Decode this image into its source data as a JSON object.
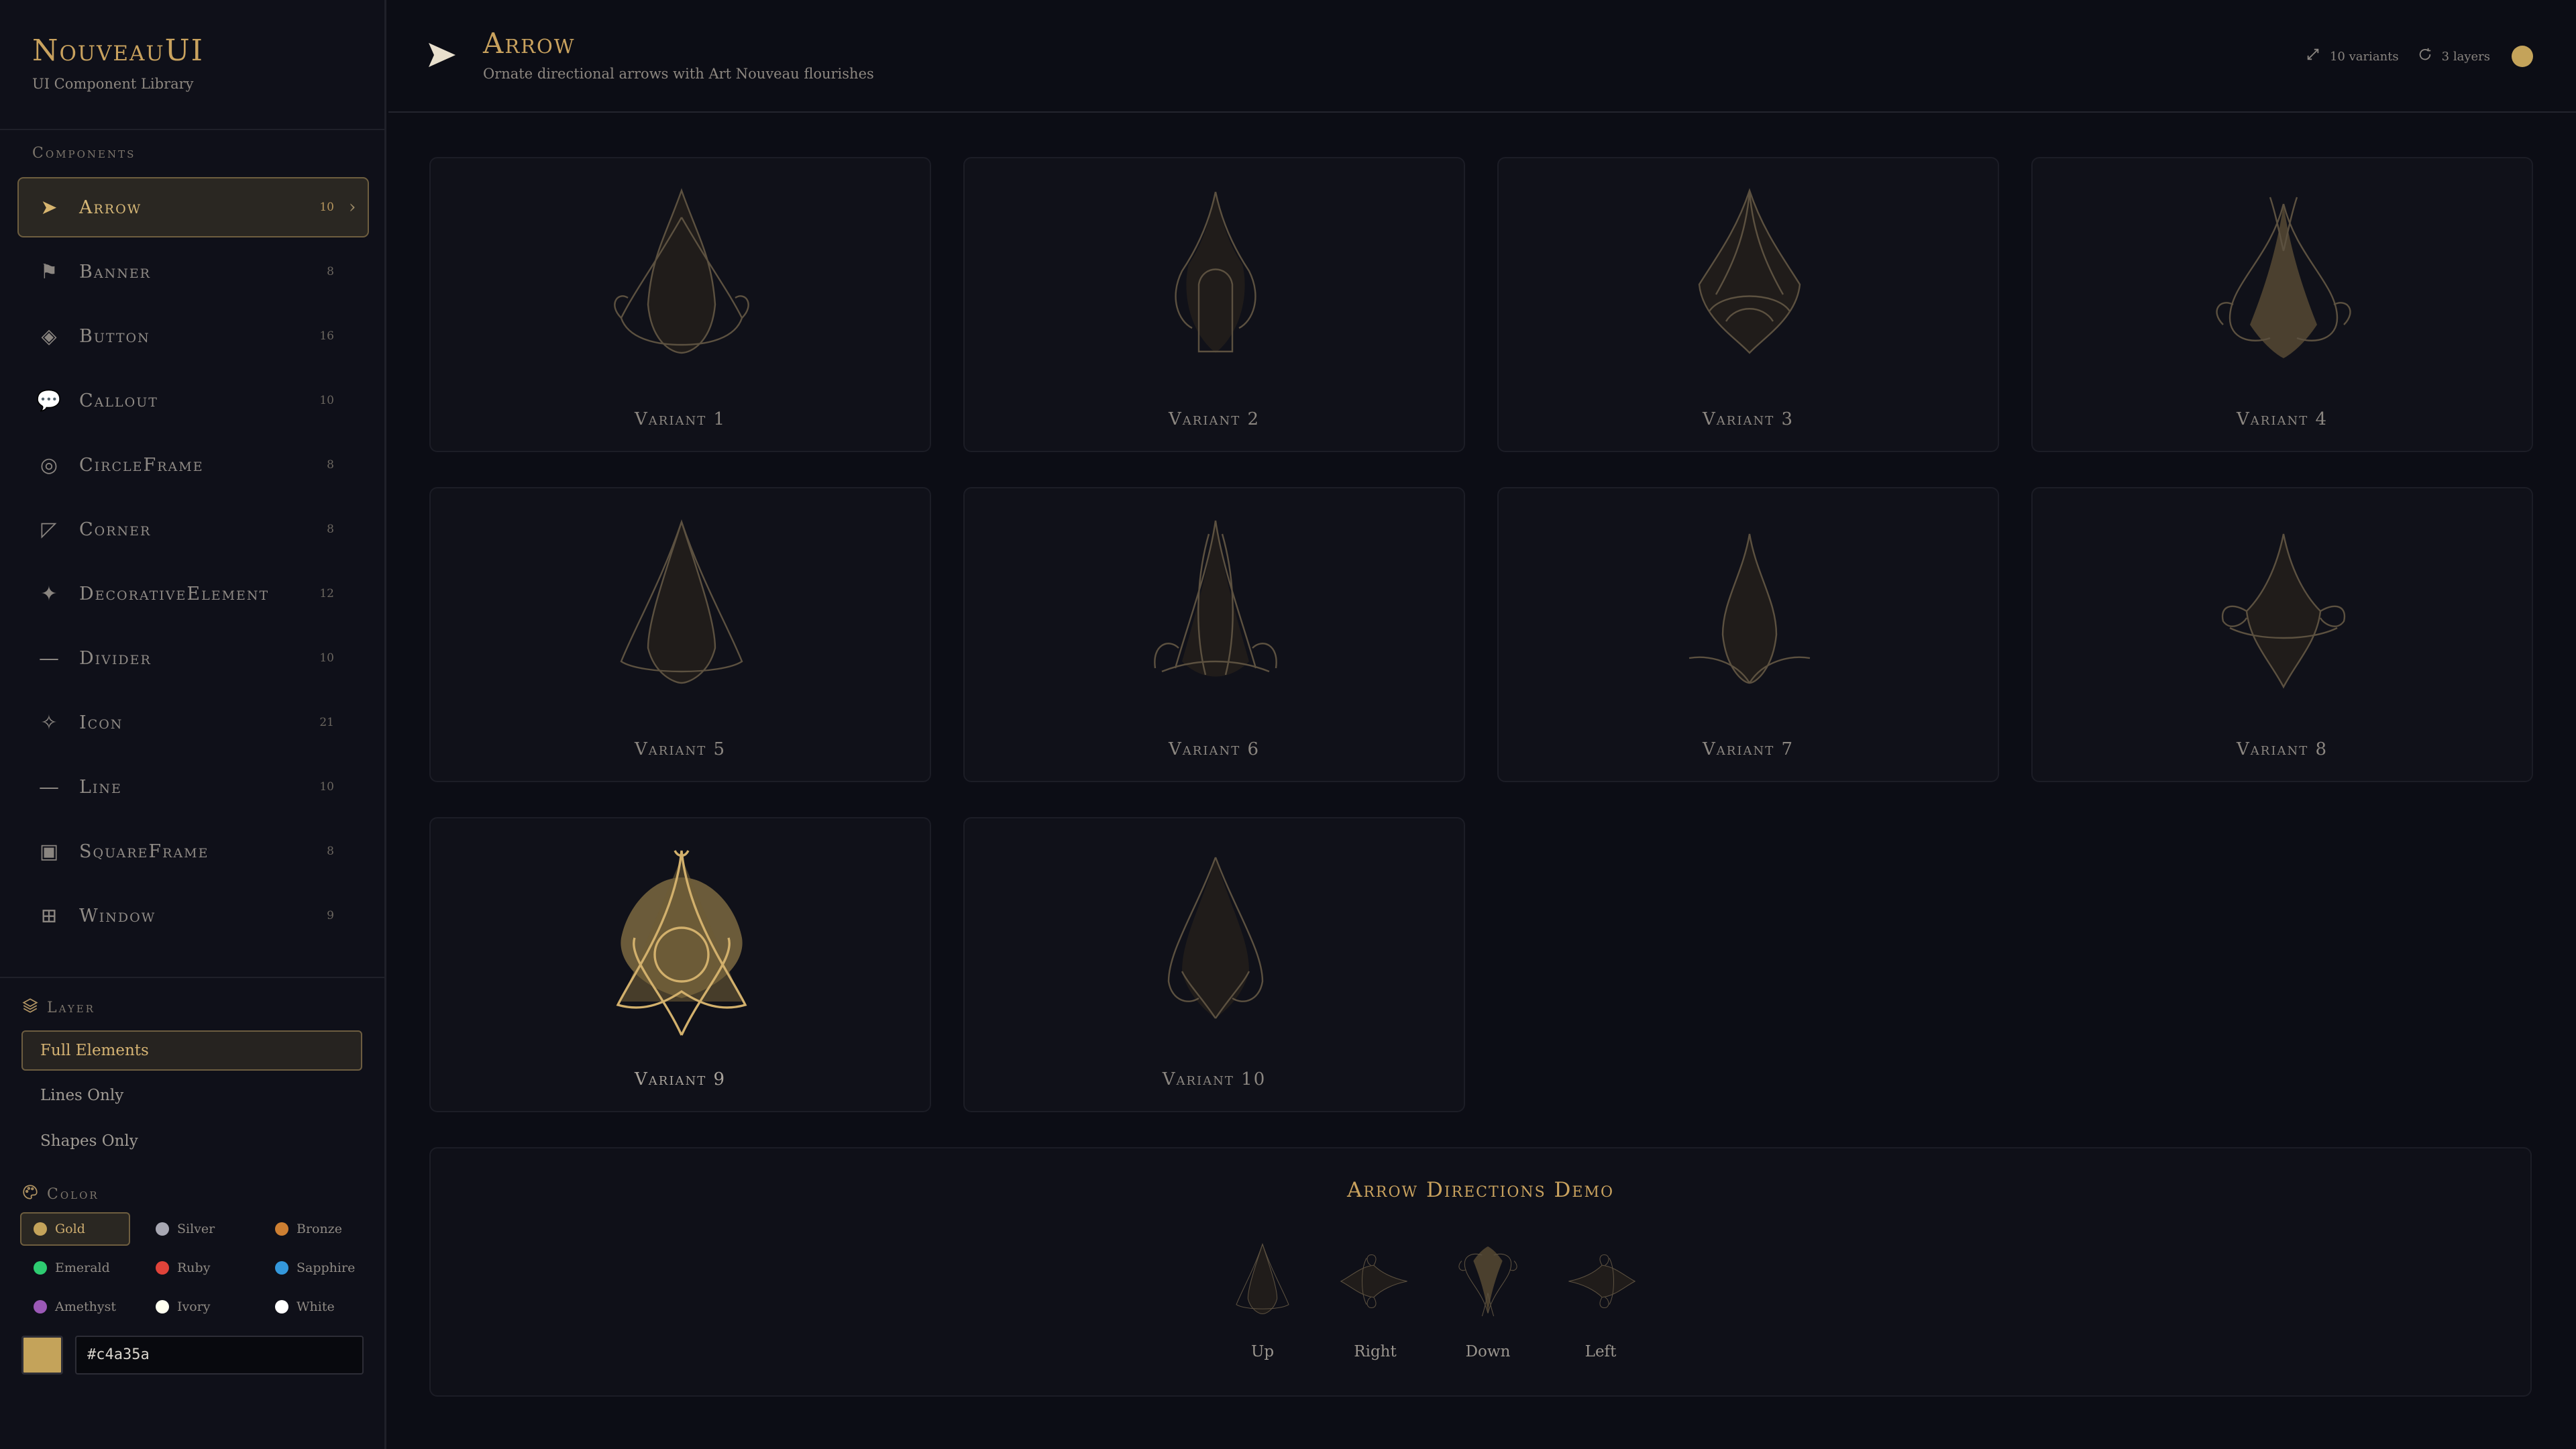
{
  "brand": {
    "title": "NouveauUI",
    "subtitle": "UI Component Library"
  },
  "sidebar": {
    "section_label": "Components",
    "items": [
      {
        "label": "Arrow",
        "count": "10",
        "icon": "arrow-icon",
        "glyph": "➤",
        "active": true
      },
      {
        "label": "Banner",
        "count": "8",
        "icon": "banner-flag-icon",
        "glyph": "⚑",
        "active": false
      },
      {
        "label": "Button",
        "count": "16",
        "icon": "button-diamond-icon",
        "glyph": "◈",
        "active": false
      },
      {
        "label": "Callout",
        "count": "10",
        "icon": "speech-bubble-icon",
        "glyph": "💬",
        "active": false
      },
      {
        "label": "CircleFrame",
        "count": "8",
        "icon": "circle-frame-icon",
        "glyph": "◎",
        "active": false
      },
      {
        "label": "Corner",
        "count": "8",
        "icon": "corner-icon",
        "glyph": "◸",
        "active": false
      },
      {
        "label": "DecorativeElement",
        "count": "12",
        "icon": "sparkle-icon",
        "glyph": "✦",
        "active": false
      },
      {
        "label": "Divider",
        "count": "10",
        "icon": "divider-icon",
        "glyph": "—",
        "active": false
      },
      {
        "label": "Icon",
        "count": "21",
        "icon": "star-outline-icon",
        "glyph": "✧",
        "active": false
      },
      {
        "label": "Line",
        "count": "10",
        "icon": "line-icon",
        "glyph": "—",
        "active": false
      },
      {
        "label": "SquareFrame",
        "count": "8",
        "icon": "square-frame-icon",
        "glyph": "▣",
        "active": false
      },
      {
        "label": "Window",
        "count": "9",
        "icon": "window-grid-icon",
        "glyph": "⊞",
        "active": false
      }
    ],
    "layer": {
      "label": "Layer",
      "options": [
        "Full Elements",
        "Lines Only",
        "Shapes Only"
      ],
      "selected": "Full Elements"
    },
    "color": {
      "label": "Color",
      "options": [
        {
          "name": "Gold",
          "hex": "#c4a35a"
        },
        {
          "name": "Silver",
          "hex": "#a8a8b3"
        },
        {
          "name": "Bronze",
          "hex": "#cd7f32"
        },
        {
          "name": "Emerald",
          "hex": "#2ecc71"
        },
        {
          "name": "Ruby",
          "hex": "#e0433a"
        },
        {
          "name": "Sapphire",
          "hex": "#3498db"
        },
        {
          "name": "Amethyst",
          "hex": "#9b59b6"
        },
        {
          "name": "Ivory",
          "hex": "#fffff0"
        },
        {
          "name": "White",
          "hex": "#ffffff"
        }
      ],
      "selected": "Gold",
      "hex_value": "#c4a35a"
    }
  },
  "header": {
    "title": "Arrow",
    "subtitle": "Ornate directional arrows with Art Nouveau flourishes",
    "variants_text": "10 variants",
    "layers_text": "3 layers",
    "accent": "#c4a35a"
  },
  "variants": [
    {
      "label": "Variant 1"
    },
    {
      "label": "Variant 2"
    },
    {
      "label": "Variant 3"
    },
    {
      "label": "Variant 4"
    },
    {
      "label": "Variant 5"
    },
    {
      "label": "Variant 6"
    },
    {
      "label": "Variant 7"
    },
    {
      "label": "Variant 8"
    },
    {
      "label": "Variant 9",
      "selected": true
    },
    {
      "label": "Variant 10"
    }
  ],
  "demo": {
    "title": "Arrow Directions Demo",
    "directions": [
      "Up",
      "Right",
      "Down",
      "Left"
    ]
  }
}
